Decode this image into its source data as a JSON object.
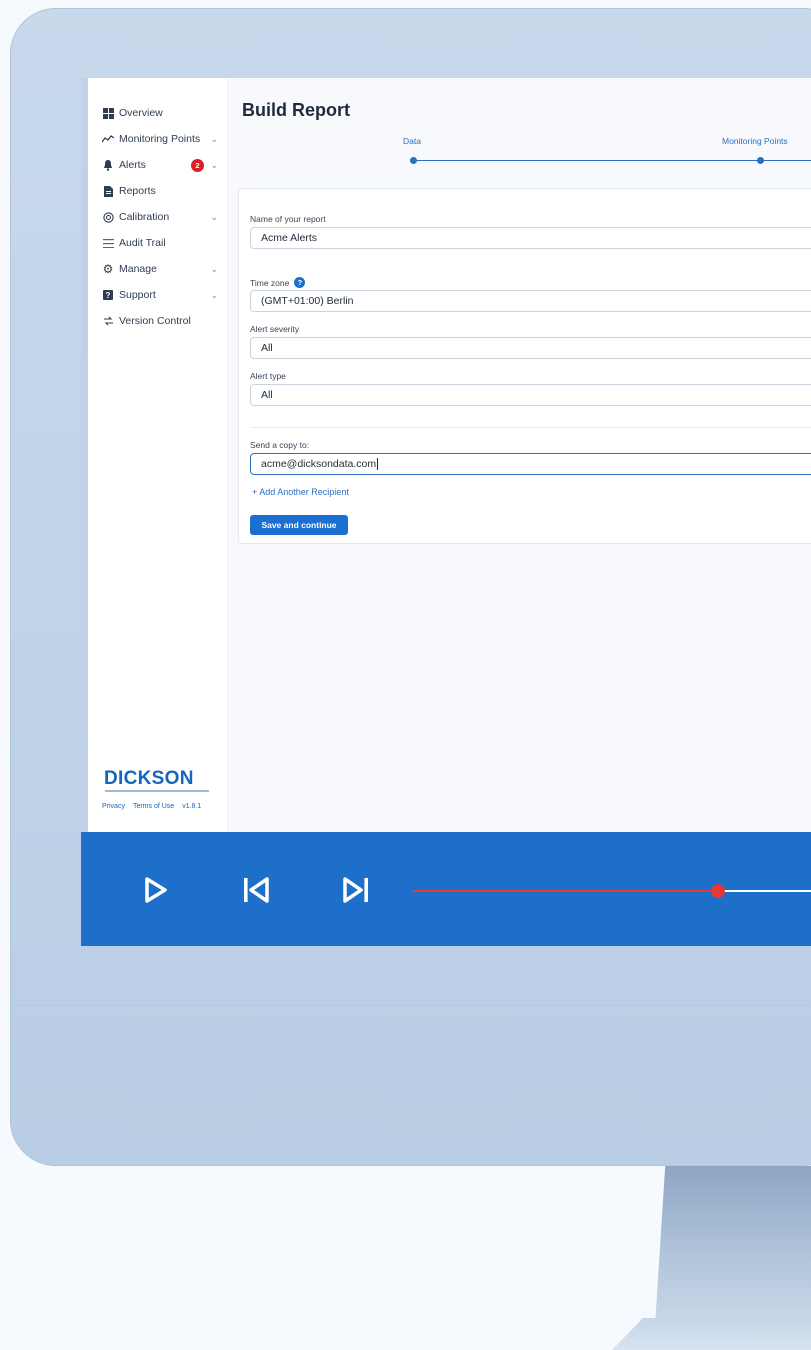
{
  "sidebar": {
    "items": [
      {
        "label": "Overview",
        "icon": "dashboard-icon"
      },
      {
        "label": "Monitoring Points",
        "icon": "chart-line-icon"
      },
      {
        "label": "Alerts",
        "icon": "bell-icon",
        "badge": "2"
      },
      {
        "label": "Reports",
        "icon": "document-icon"
      },
      {
        "label": "Calibration",
        "icon": "calibration-icon"
      },
      {
        "label": "Audit Trail",
        "icon": "list-icon"
      },
      {
        "label": "Manage",
        "icon": "gear-icon"
      },
      {
        "label": "Support",
        "icon": "help-icon"
      },
      {
        "label": "Version Control",
        "icon": "version-icon"
      }
    ],
    "logo": "DICKSON",
    "footer": {
      "privacy": "Privacy",
      "terms": "Terms of Use",
      "version": "v1.8.1"
    }
  },
  "main": {
    "title": "Build Report",
    "steps": [
      {
        "label": "Data"
      },
      {
        "label": "Monitoring Points"
      }
    ],
    "form": {
      "report_name_label": "Name of your report",
      "report_name_value": "Acme Alerts",
      "timezone_label": "Time zone",
      "timezone_value": "(GMT+01:00) Berlin",
      "severity_label": "Alert severity",
      "severity_value": "All",
      "type_label": "Alert type",
      "type_value": "All",
      "copy_label": "Send a copy to:",
      "copy_value": "acme@dicksondata.com",
      "add_recipient": "+ Add Another Recipient",
      "save_label": "Save and continue"
    }
  },
  "player": {
    "progress": 0.75
  },
  "colors": {
    "accent": "#1e6fc9",
    "badge": "#d81f26",
    "progress": "#e53935"
  }
}
